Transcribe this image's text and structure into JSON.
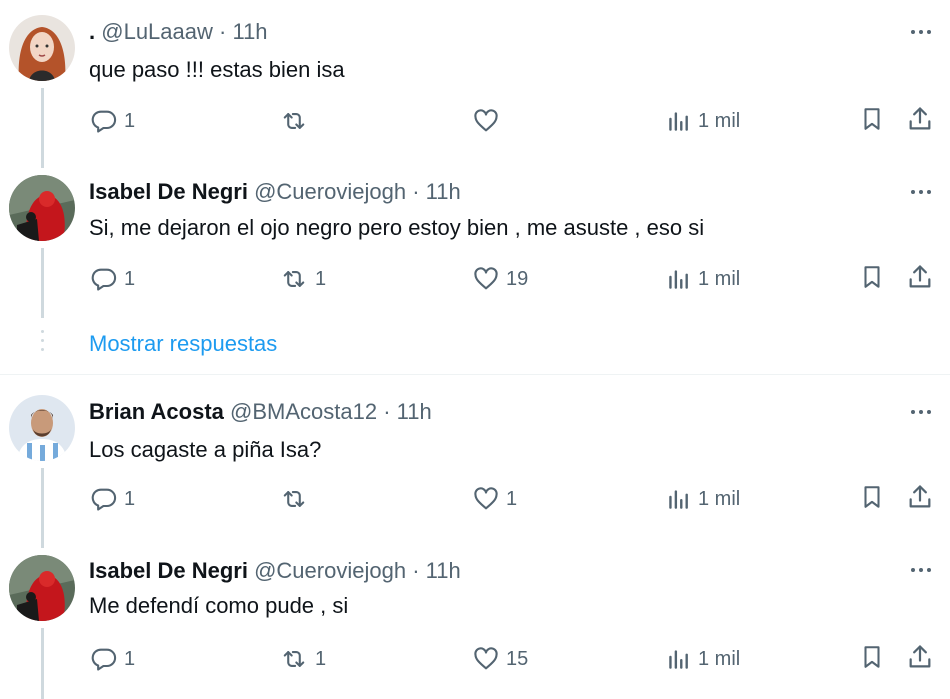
{
  "colors": {
    "accent": "#1d9bf0",
    "secondary_text": "#536471",
    "line": "#cfd9de"
  },
  "show_replies_label": "Mostrar respuestas",
  "tweets": [
    {
      "name": ".",
      "handle": "@LuLaaaw",
      "dot": "·",
      "time": "11h",
      "text": "que paso !!! estas bien  isa",
      "replies": "1",
      "retweets": "",
      "likes": "",
      "views": "1 mil",
      "avatar": "avatar-red-hair-woman"
    },
    {
      "name": "Isabel De Negri",
      "handle": "@Cueroviejogh",
      "dot": "·",
      "time": "11h",
      "text": "Si, me dejaron el ojo negro pero estoy bien , me asuste , eso si",
      "replies": "1",
      "retweets": "1",
      "likes": "19",
      "views": "1 mil",
      "avatar": "avatar-red-figure"
    },
    {
      "name": "Brian Acosta",
      "handle": "@BMAcosta12",
      "dot": "·",
      "time": "11h",
      "text": "Los cagaste a piña Isa?",
      "replies": "1",
      "retweets": "",
      "likes": "1",
      "views": "1 mil",
      "avatar": "avatar-football-player"
    },
    {
      "name": "Isabel De Negri",
      "handle": "@Cueroviejogh",
      "dot": "·",
      "time": "11h",
      "text": "Me defendí como pude , si",
      "replies": "1",
      "retweets": "1",
      "likes": "15",
      "views": "1 mil",
      "avatar": "avatar-red-figure"
    }
  ]
}
